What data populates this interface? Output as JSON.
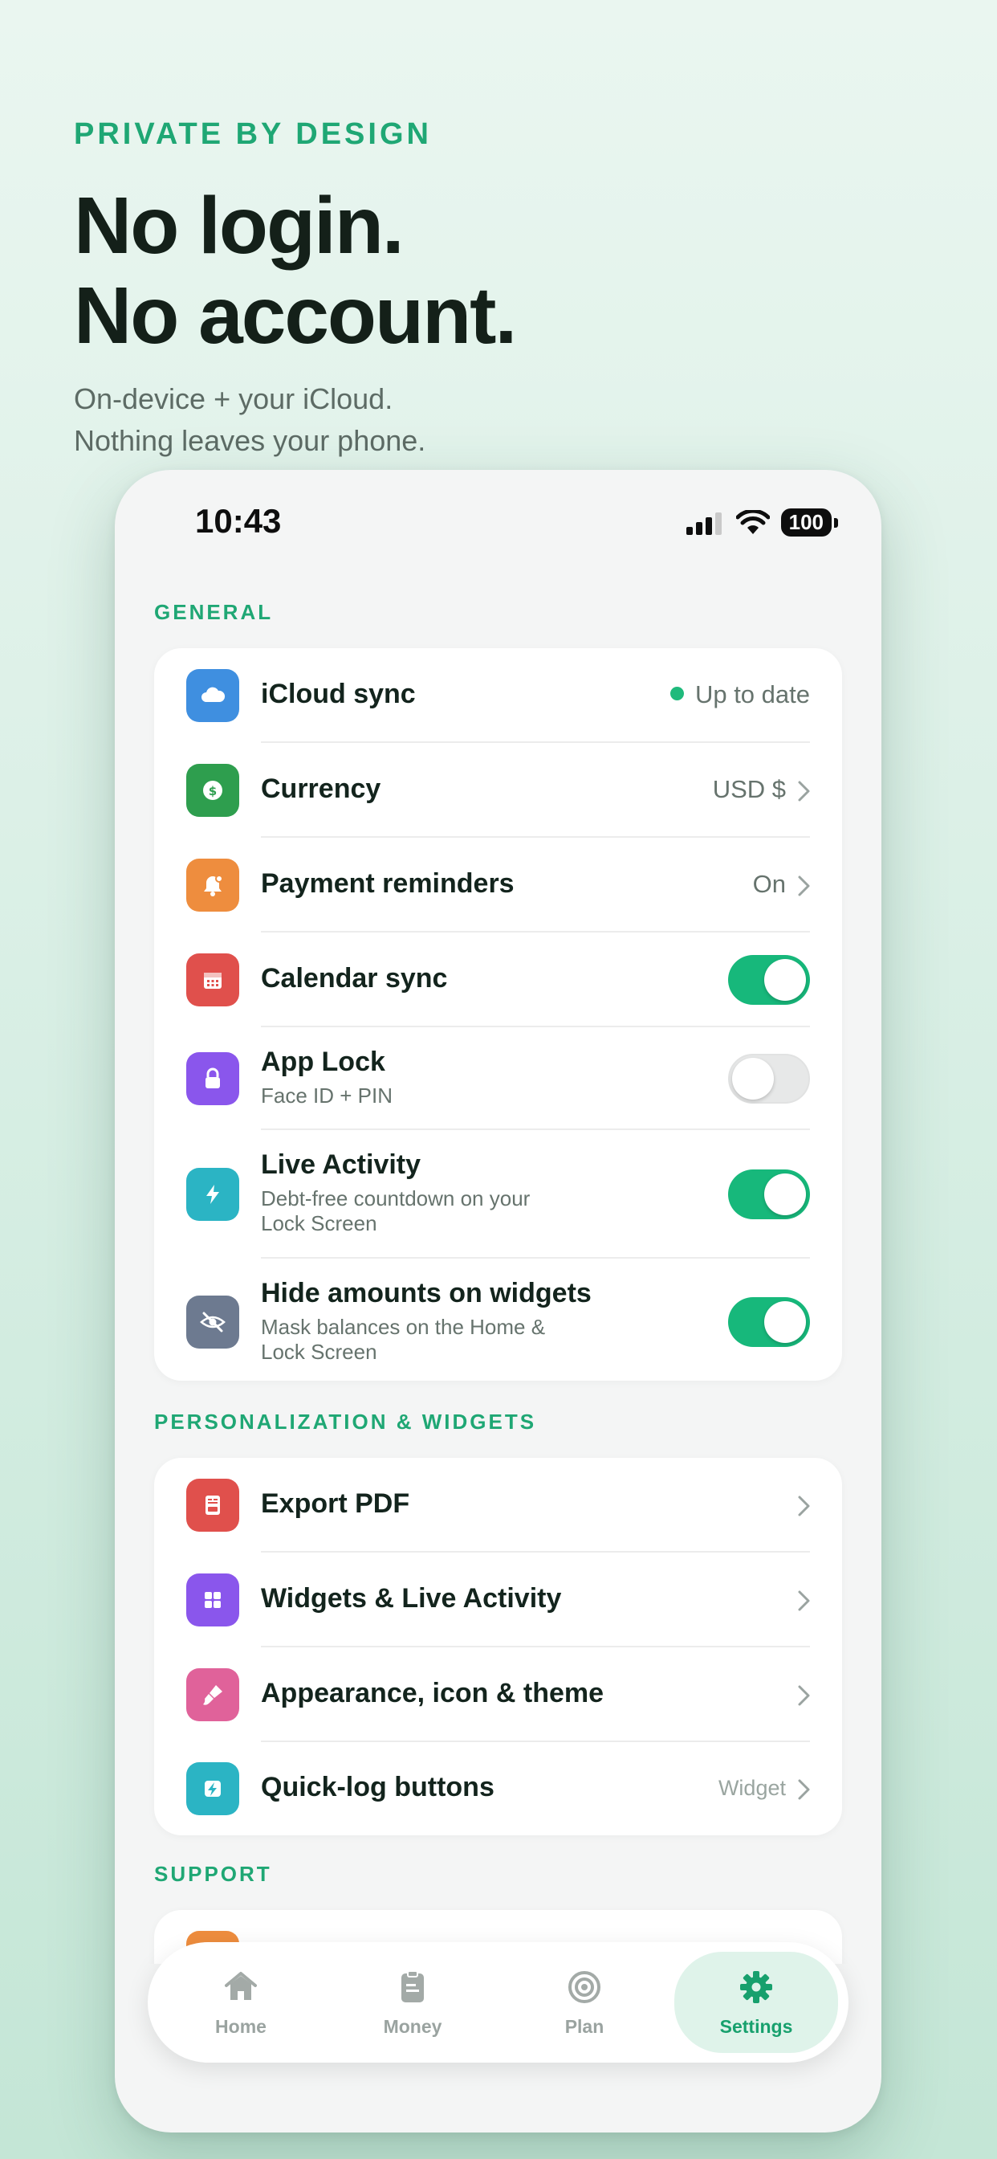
{
  "hero": {
    "eyebrow": "PRIVATE BY DESIGN",
    "headline_line1": "No login.",
    "headline_line2": "No account.",
    "subtitle_line1": "On-device + your iCloud.",
    "subtitle_line2": "Nothing leaves your phone."
  },
  "status_bar": {
    "time": "10:43",
    "battery": "100"
  },
  "sections": {
    "general": {
      "label": "GENERAL",
      "rows": {
        "icloud": {
          "title": "iCloud sync",
          "value": "Up to date",
          "icon": "cloud-icon",
          "color": "#3f8fe0"
        },
        "currency": {
          "title": "Currency",
          "value": "USD $",
          "icon": "dollar-icon",
          "color": "#2e9e4e"
        },
        "reminders": {
          "title": "Payment reminders",
          "value": "On",
          "icon": "bell-icon",
          "color": "#ee8d3e"
        },
        "calendar": {
          "title": "Calendar sync",
          "toggle": true,
          "icon": "calendar-icon",
          "color": "#e0504c"
        },
        "applock": {
          "title": "App Lock",
          "subtitle": "Face ID + PIN",
          "toggle": false,
          "icon": "lock-icon",
          "color": "#8a56ec"
        },
        "live": {
          "title": "Live Activity",
          "subtitle_line1": "Debt-free countdown on your",
          "subtitle_line2": "Lock Screen",
          "toggle": true,
          "icon": "bolt-icon",
          "color": "#2bb4c4"
        },
        "hide": {
          "title": "Hide amounts on widgets",
          "subtitle_line1": "Mask balances on the Home &",
          "subtitle_line2": "Lock Screen",
          "toggle": true,
          "icon": "eye-slash-icon",
          "color": "#6d7a90"
        }
      }
    },
    "personalization": {
      "label": "PERSONALIZATION & WIDGETS",
      "rows": {
        "export": {
          "title": "Export PDF",
          "icon": "pdf-icon",
          "color": "#e0504c"
        },
        "widgets": {
          "title": "Widgets & Live Activity",
          "icon": "grid-icon",
          "color": "#8a56ec"
        },
        "appearance": {
          "title": "Appearance, icon & theme",
          "icon": "brush-icon",
          "color": "#e0629a"
        },
        "quicklog": {
          "title": "Quick-log buttons",
          "value": "Widget",
          "icon": "quick-bolt-icon",
          "color": "#2bb4c4"
        }
      }
    },
    "support": {
      "label": "SUPPORT"
    }
  },
  "tabs": {
    "home": "Home",
    "money": "Money",
    "plan": "Plan",
    "settings": "Settings",
    "active": "settings"
  },
  "colors": {
    "accent": "#1fa774",
    "toggle_on": "#17b87b"
  }
}
